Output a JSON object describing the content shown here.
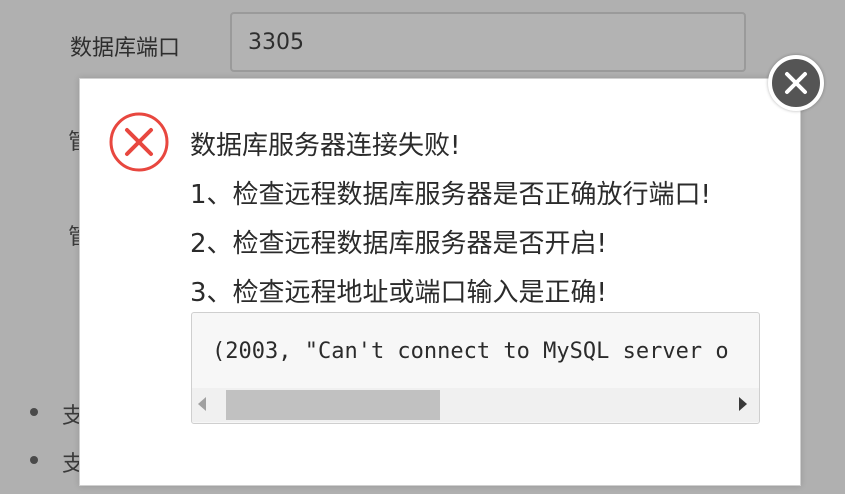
{
  "background_form": {
    "port_label": "数据库端口",
    "port_value": "3305",
    "row2_partial": "管",
    "row3_partial": "管",
    "bullet1_partial": "支",
    "bullet2_partial": "支"
  },
  "dialog": {
    "messages": [
      "数据库服务器连接失败!",
      "1、检查远程数据库服务器是否正确放行端口!",
      "2、检查远程数据库服务器是否开启!",
      "3、检查远程地址或端口输入是正确!"
    ],
    "error_detail": "(2003, \"Can't connect to MySQL server o",
    "icons": {
      "status": "error-x-circle-icon",
      "close": "close-icon"
    },
    "colors": {
      "error_red": "#e8473f",
      "close_bg": "#555555"
    }
  }
}
